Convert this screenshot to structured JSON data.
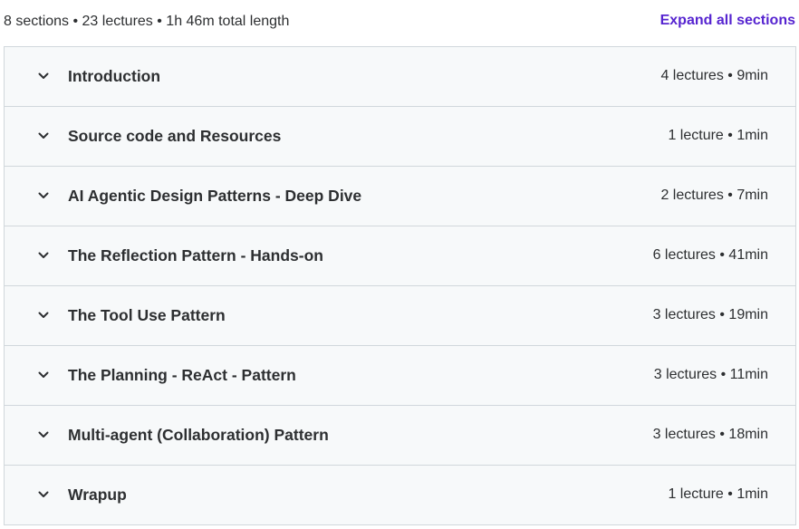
{
  "summary": {
    "text": "8 sections • 23 lectures • 1h 46m total length",
    "expand_all_label": "Expand all sections"
  },
  "sections": [
    {
      "title": "Introduction",
      "meta": "4 lectures • 9min"
    },
    {
      "title": "Source code and Resources",
      "meta": "1 lecture • 1min"
    },
    {
      "title": "AI Agentic Design Patterns - Deep Dive",
      "meta": "2 lectures • 7min"
    },
    {
      "title": "The Reflection Pattern - Hands-on",
      "meta": "6 lectures • 41min"
    },
    {
      "title": "The Tool Use Pattern",
      "meta": "3 lectures • 19min"
    },
    {
      "title": "The Planning - ReAct - Pattern",
      "meta": "3 lectures • 11min"
    },
    {
      "title": "Multi-agent (Collaboration) Pattern",
      "meta": "3 lectures • 18min"
    },
    {
      "title": "Wrapup",
      "meta": "1 lecture • 1min"
    }
  ],
  "icons": {
    "section_toggle": "chevron-down-icon"
  },
  "colors": {
    "accent": "#5624d0",
    "text": "#2d2f31",
    "section_bg": "#f7f9fa",
    "border": "#d1d7dc"
  }
}
